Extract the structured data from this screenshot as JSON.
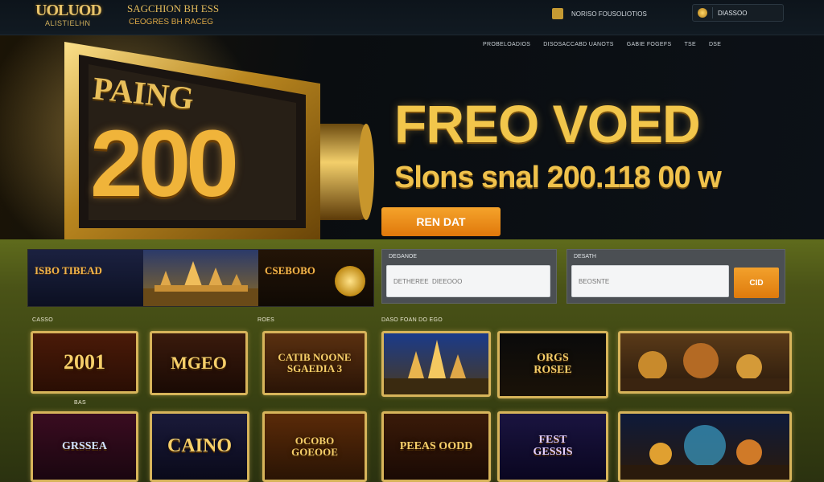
{
  "header": {
    "logo": "UOLUOD",
    "logo_sub": "ALISTIELHN",
    "tagline_1": "SAGCHION BH ESS",
    "tagline_2": "CEOGRES BH RACEG",
    "account_text": "NORISO FOUSOLIOTIOS",
    "balance_text": "DIASSOO",
    "icon_account": "user-badge-icon",
    "icon_coin": "coin-icon"
  },
  "nav": {
    "items": [
      "PROBELOADIOS",
      "DISOSACCABD UANOTS",
      "GABIE FOGEFS",
      "TSE",
      "DSE"
    ]
  },
  "hero": {
    "badge_line": "PAING",
    "badge_number": "200",
    "title": "FREO VOED",
    "subtitle": "Slons snal 200.118 00 w",
    "cta_label": "REN DAT"
  },
  "promos": [
    {
      "label": "ISBO TIBEAD"
    },
    {
      "label": ""
    },
    {
      "label": "CSEBOBO"
    }
  ],
  "forms": {
    "panel_1": {
      "label": "DEGANOE",
      "placeholder": "DETHEREE  DIEEOOO"
    },
    "panel_2": {
      "label": "DESATH",
      "placeholder": "BEOSNTE"
    },
    "go_label": "CID"
  },
  "sections": {
    "label_1": "CASSO",
    "label_2": "ROES",
    "label_3": "DASO FOAN DO EGO",
    "label_4": "BAS"
  },
  "games": [
    {
      "title": "2001"
    },
    {
      "title": "MGEO"
    },
    {
      "title": "CATIB NOONE\nSGAEDIA 3"
    },
    {
      "title": ""
    },
    {
      "title": "ORGS\nROSEE"
    },
    {
      "title": ""
    },
    {
      "title": "GRSSEA"
    },
    {
      "title": "CAINO"
    },
    {
      "title": "OCOBO\nGOEOOE"
    },
    {
      "title": "PEEAS OODD"
    },
    {
      "title": "FEST\nGESSIS"
    },
    {
      "title": ""
    }
  ],
  "colors": {
    "gold": "#f2c64b",
    "accent_orange": "#e8881a",
    "frame_gold": "#d7b45a",
    "floor_olive": "#4a5317"
  }
}
